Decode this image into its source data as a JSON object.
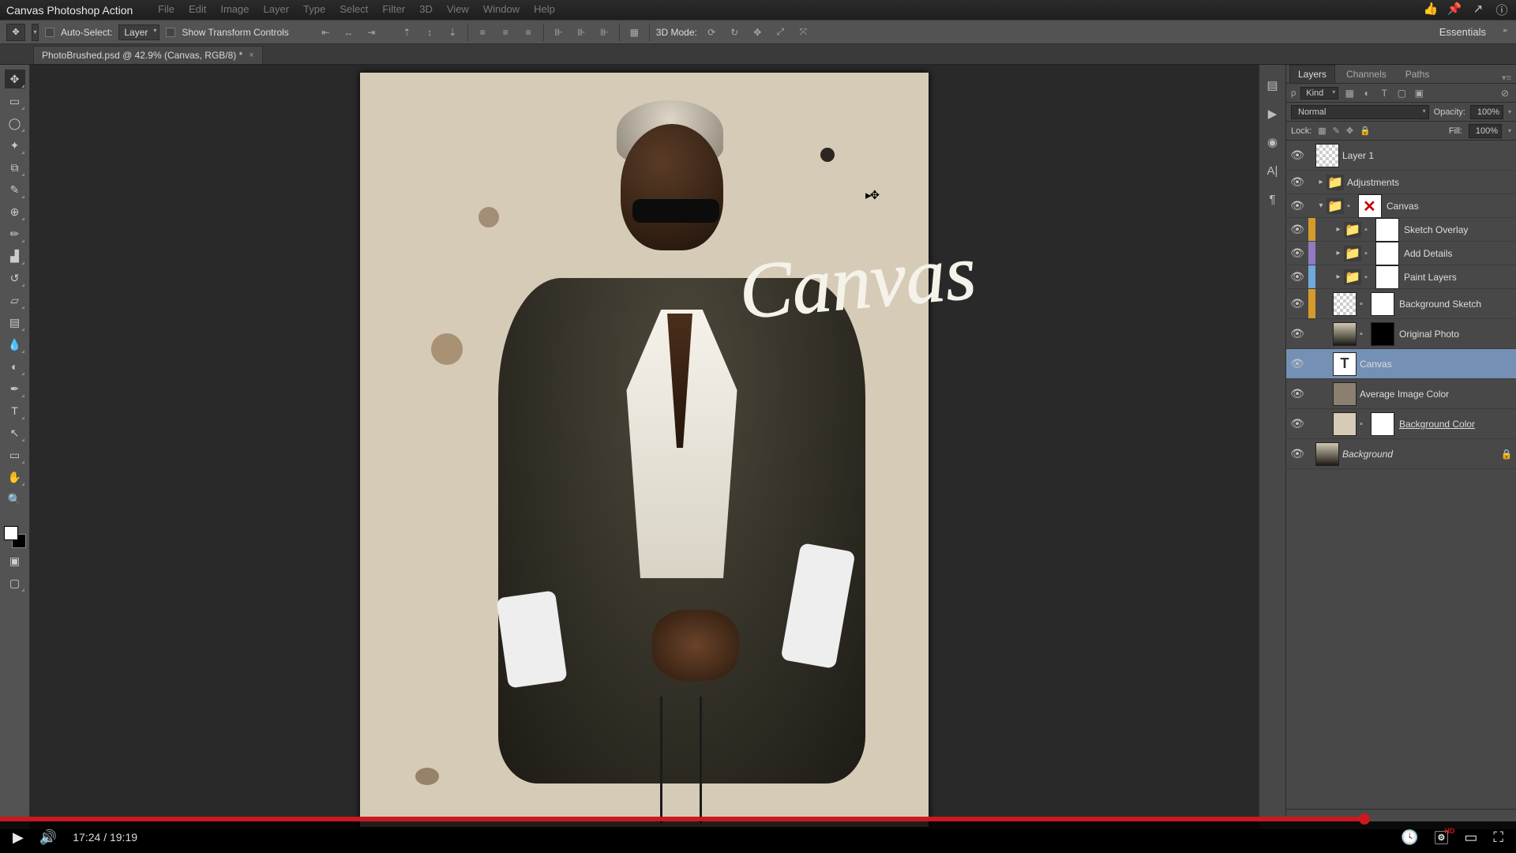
{
  "app": {
    "title": "Canvas Photoshop Action",
    "menus": [
      "File",
      "Edit",
      "Image",
      "Layer",
      "Type",
      "Select",
      "Filter",
      "3D",
      "View",
      "Window",
      "Help"
    ]
  },
  "optbar": {
    "auto_select": "Auto-Select:",
    "auto_select_kind": "Layer",
    "show_tc": "Show Transform Controls",
    "mode3d": "3D Mode:"
  },
  "workspace": "Essentials",
  "doc": {
    "tab": "PhotoBrushed.psd @ 42.9% (Canvas, RGB/8) *"
  },
  "panels": {
    "tabs": [
      "Layers",
      "Channels",
      "Paths"
    ],
    "kind": "Kind",
    "blend": "Normal",
    "opacity_label": "Opacity:",
    "opacity": "100%",
    "fill_label": "Fill:",
    "fill": "100%",
    "lock_label": "Lock:"
  },
  "layers": [
    {
      "id": "layer1",
      "type": "layer",
      "name": "Layer 1",
      "thumb": "trans"
    },
    {
      "id": "adjustments",
      "type": "group",
      "name": "Adjustments",
      "expand": "closed"
    },
    {
      "id": "canvas-grp",
      "type": "group",
      "name": "Canvas",
      "expand": "open",
      "mask": true,
      "mask_x": true
    },
    {
      "id": "sketch",
      "type": "group",
      "name": "Sketch Overlay",
      "indent": 1,
      "color": "#d49b2a",
      "expand": "closed",
      "mask": true
    },
    {
      "id": "details",
      "type": "group",
      "name": "Add Details",
      "indent": 1,
      "color": "#8e7cc3",
      "expand": "closed",
      "mask": true
    },
    {
      "id": "paint",
      "type": "group",
      "name": "Paint Layers",
      "indent": 1,
      "color": "#6fa8dc",
      "expand": "closed",
      "mask": true
    },
    {
      "id": "bgsketch",
      "type": "layer",
      "name": "Background Sketch",
      "indent": 1,
      "color": "#d49b2a",
      "thumb": "trans",
      "mask": true
    },
    {
      "id": "orig",
      "type": "layer",
      "name": "Original Photo",
      "indent": 1,
      "thumb": "photo",
      "mask": "blk"
    },
    {
      "id": "canvas-t",
      "type": "text",
      "name": "Canvas",
      "indent": 1,
      "selected": true
    },
    {
      "id": "avg",
      "type": "layer",
      "name": "Average Image Color",
      "indent": 1,
      "thumb": "flat",
      "flat": "#8b8070"
    },
    {
      "id": "bgcolor",
      "type": "layer",
      "name": "Background Color",
      "indent": 1,
      "thumb": "flat",
      "flat": "#d6cbb7",
      "mask": true,
      "underline": true
    },
    {
      "id": "bg",
      "type": "layer",
      "name": "Background",
      "thumb": "photo",
      "locked": true,
      "italic": true
    }
  ],
  "canvas": {
    "script_text": "Canvas"
  },
  "video": {
    "elapsed": "17:24",
    "total": "19:19",
    "progress_pct": 90
  }
}
